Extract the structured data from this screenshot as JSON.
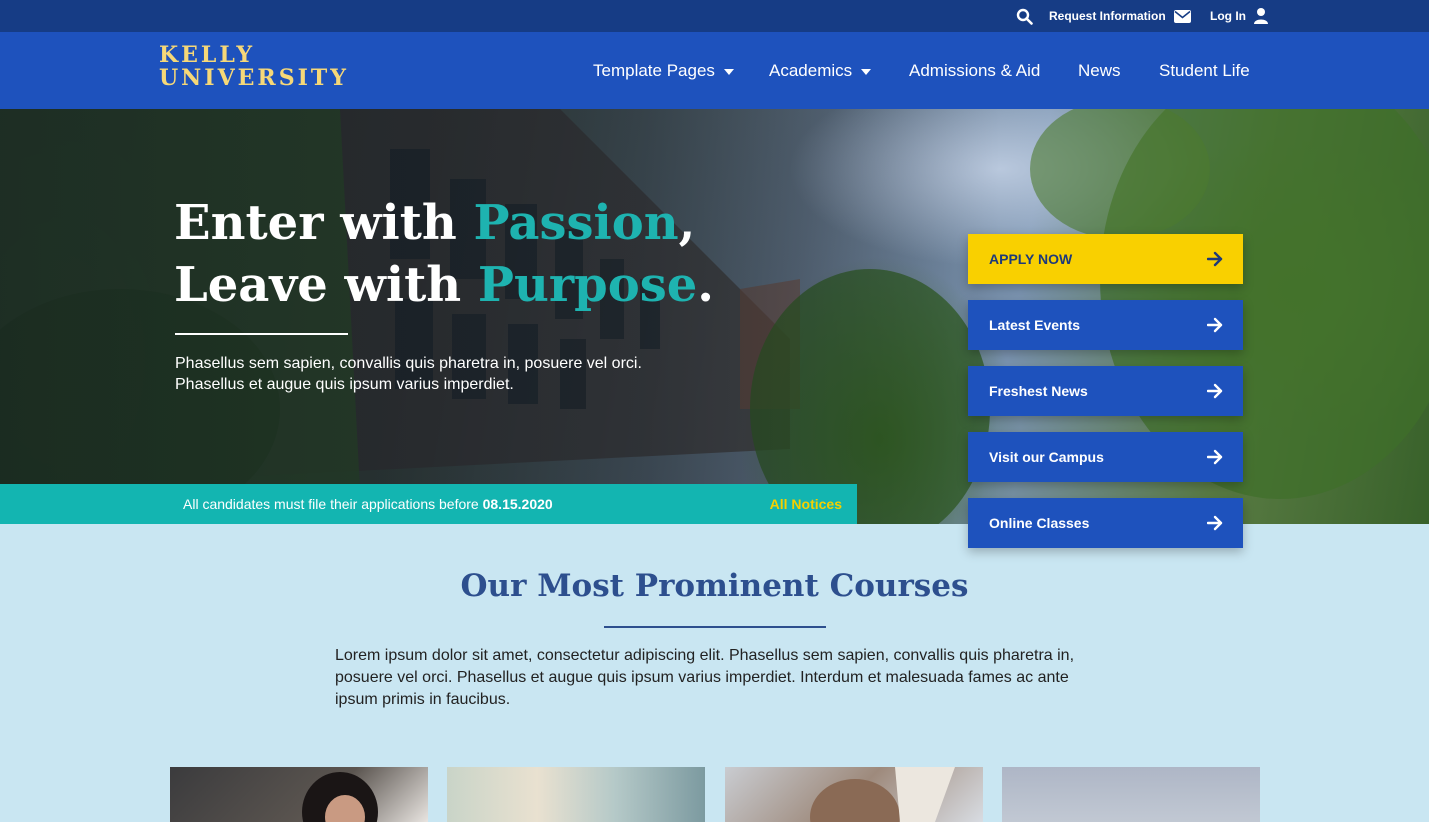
{
  "topbar": {
    "request_info": "Request Information",
    "login": "Log In"
  },
  "brand": {
    "line1": "KELLY",
    "line2": "UNIVERSITY"
  },
  "nav": {
    "items": [
      {
        "label": "Template Pages"
      },
      {
        "label": "Academics"
      },
      {
        "label": "Admissions & Aid"
      },
      {
        "label": "News"
      },
      {
        "label": "Student Life"
      }
    ]
  },
  "hero": {
    "line1_start": "Enter with ",
    "line1_accent": "Passion",
    "line1_end": ",",
    "line2_start": "Leave with ",
    "line2_accent": "Purpose",
    "line2_end": ".",
    "body": "Phasellus sem sapien, convallis quis pharetra in, posuere vel orci. Phasellus et augue quis ipsum varius imperdiet.",
    "accent_color": "#1eb3b0"
  },
  "notice": {
    "text": "All candidates must file their applications before ",
    "date": "08.15.2020",
    "link": "All Notices"
  },
  "cta": {
    "apply": "APPLY NOW",
    "events": "Latest Events",
    "news": "Freshest News",
    "visit": "Visit our Campus",
    "online": "Online Classes"
  },
  "courses": {
    "title": "Our Most Prominent Courses",
    "body": "Lorem ipsum dolor sit amet, consectetur adipiscing elit. Phasellus sem sapien, convallis quis pharetra in, posuere vel orci. Phasellus et augue quis ipsum varius imperdiet. Interdum et malesuada fames ac ante ipsum primis in faucibus."
  },
  "colors": {
    "topbar": "#163c85",
    "navbar": "#1e52bd",
    "notice": "#13b5b1",
    "apply": "#f9d000",
    "page_bg": "#c9e6f2"
  }
}
